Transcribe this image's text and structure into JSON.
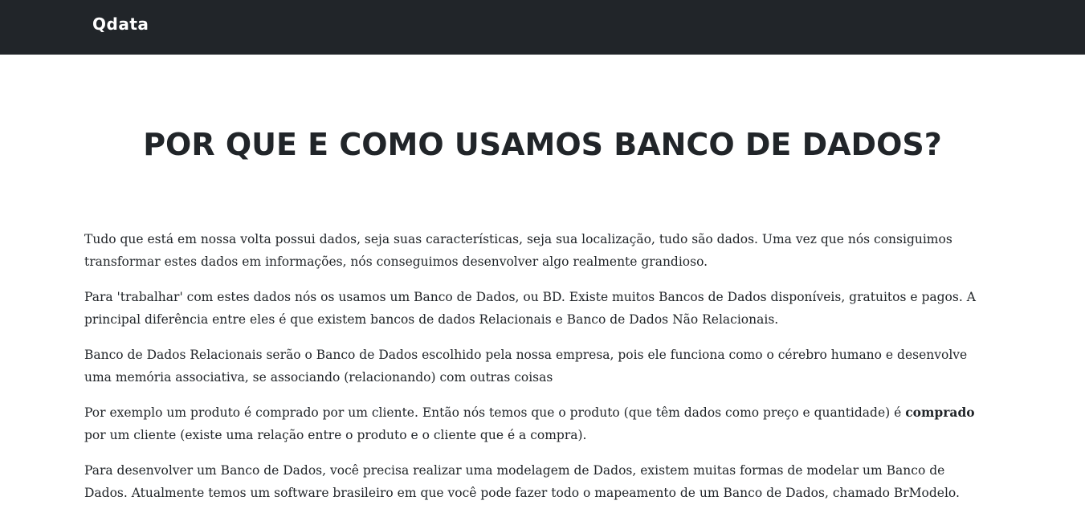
{
  "navbar": {
    "brand": "Qdata"
  },
  "main": {
    "title": "POR QUE E COMO USAMOS BANCO DE DADOS?",
    "paragraphs": [
      "Tudo que está em nossa volta possui dados, seja suas características, seja sua localização, tudo são dados. Uma vez que nós consiguimos transformar estes dados em informações, nós conseguimos desenvolver algo realmente grandioso.",
      "Para 'trabalhar' com estes dados nós os usamos um Banco de Dados, ou BD. Existe muitos Bancos de Dados disponíveis, gratuitos e pagos. A principal diferência entre eles é que existem bancos de dados Relacionais e Banco de Dados Não Relacionais.",
      "Banco de Dados Relacionais serão o Banco de Dados escolhido pela nossa empresa, pois ele funciona como o cérebro humano e desenvolve uma memória associativa, se associando (relacionando) com outras coisas"
    ],
    "p4": {
      "before": "Por exemplo um produto é comprado por um cliente. Então nós temos que o produto (que têm dados como preço e quantidade) é ",
      "bold": "comprado",
      "after": " por um cliente (existe uma relação entre o produto e o cliente que é a compra)."
    },
    "p5": "Para desenvolver um Banco de Dados, você precisa realizar uma modelagem de Dados, existem muitas formas de modelar um Banco de Dados. Atualmente temos um software brasileiro em que você pode fazer todo o mapeamento de um Banco de Dados, chamado BrModelo."
  },
  "colors": {
    "navbar_bg": "#212529",
    "text": "#212529",
    "brand": "#ffffff"
  }
}
